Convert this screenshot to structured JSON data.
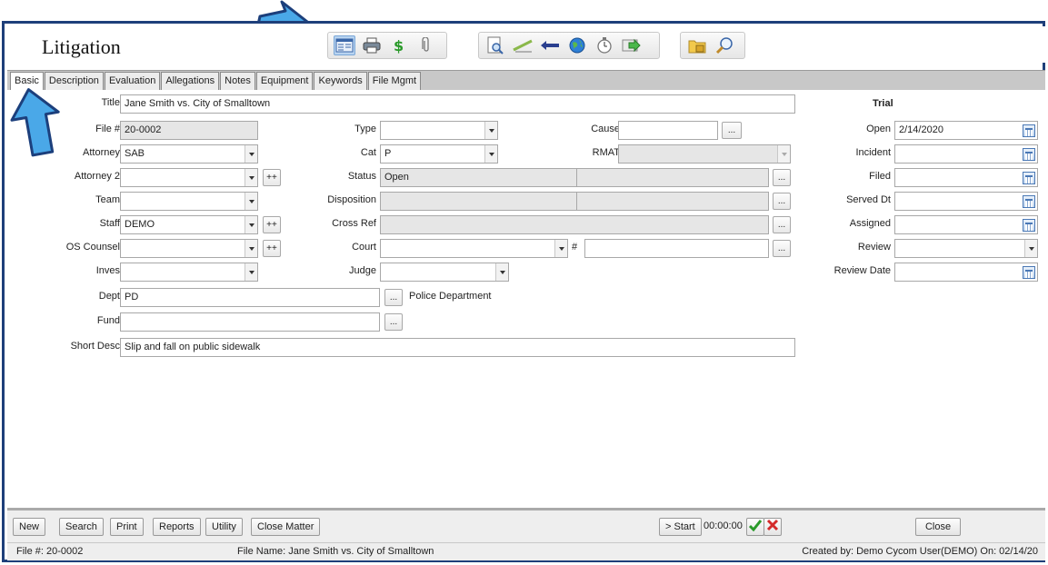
{
  "window": {
    "title": "Litigation"
  },
  "toolbar": {
    "group1": [
      {
        "icon": "form-view-icon",
        "active": true
      },
      {
        "icon": "printer-icon"
      },
      {
        "icon": "dollar-icon"
      },
      {
        "icon": "paperclip-icon"
      }
    ],
    "group2": [
      {
        "icon": "document-search-icon"
      },
      {
        "icon": "pencil-ruler-icon"
      },
      {
        "icon": "swap-arrows-icon"
      },
      {
        "icon": "globe-icon"
      },
      {
        "icon": "stopwatch-icon"
      },
      {
        "icon": "export-arrow-icon"
      }
    ],
    "group3": [
      {
        "icon": "folder-lock-icon"
      },
      {
        "icon": "magnifier-icon"
      }
    ]
  },
  "tabs": [
    "Basic",
    "Description",
    "Evaluation",
    "Allegations",
    "Notes",
    "Equipment",
    "Keywords",
    "File Mgmt"
  ],
  "form": {
    "title_label": "Title",
    "title_value": "Jane Smith vs. City of Smalltown",
    "file_label": "File #",
    "file_value": "20-0002",
    "attorney_label": "Attorney",
    "attorney_value": "SAB",
    "attorney2_label": "Attorney 2",
    "team_label": "Team",
    "staff_label": "Staff",
    "staff_value": "DEMO",
    "os_counsel_label": "OS Counsel",
    "inves_label": "Inves",
    "dept_label": "Dept",
    "dept_value": "PD",
    "dept_desc": "Police Department",
    "fund_label": "Fund",
    "short_desc_label": "Short Desc",
    "short_desc_value": "Slip and fall on public sidewalk",
    "type_label": "Type",
    "cat_label": "Cat",
    "cat_value": "P",
    "status_label": "Status",
    "status_value": "Open",
    "disposition_label": "Disposition",
    "cross_ref_label": "Cross Ref",
    "court_label": "Court",
    "court_hash": "#",
    "judge_label": "Judge",
    "cause_label": "Cause",
    "rmat_label": "RMAT",
    "ellipsis": "...",
    "plusplus": "++"
  },
  "trial": {
    "heading": "Trial",
    "open_label": "Open",
    "open_value": "2/14/2020",
    "incident_label": "Incident",
    "filed_label": "Filed",
    "served_label": "Served Dt",
    "assigned_label": "Assigned",
    "review_label": "Review",
    "review_date_label": "Review Date"
  },
  "bottom": {
    "new": "New",
    "search": "Search",
    "print": "Print",
    "reports": "Reports",
    "utility": "Utility",
    "close_matter": "Close Matter",
    "start": "> Start",
    "timer": "00:00:00",
    "close": "Close"
  },
  "status": {
    "file": "File #: 20-0002",
    "file_name": "File Name: Jane Smith vs. City of Smalltown",
    "created": "Created by: Demo Cycom User(DEMO) On: 02/14/20"
  },
  "colors": {
    "frame": "#1e3f7a",
    "arrow": "#4aa8e8",
    "arrow_outline": "#1c3f7c"
  }
}
